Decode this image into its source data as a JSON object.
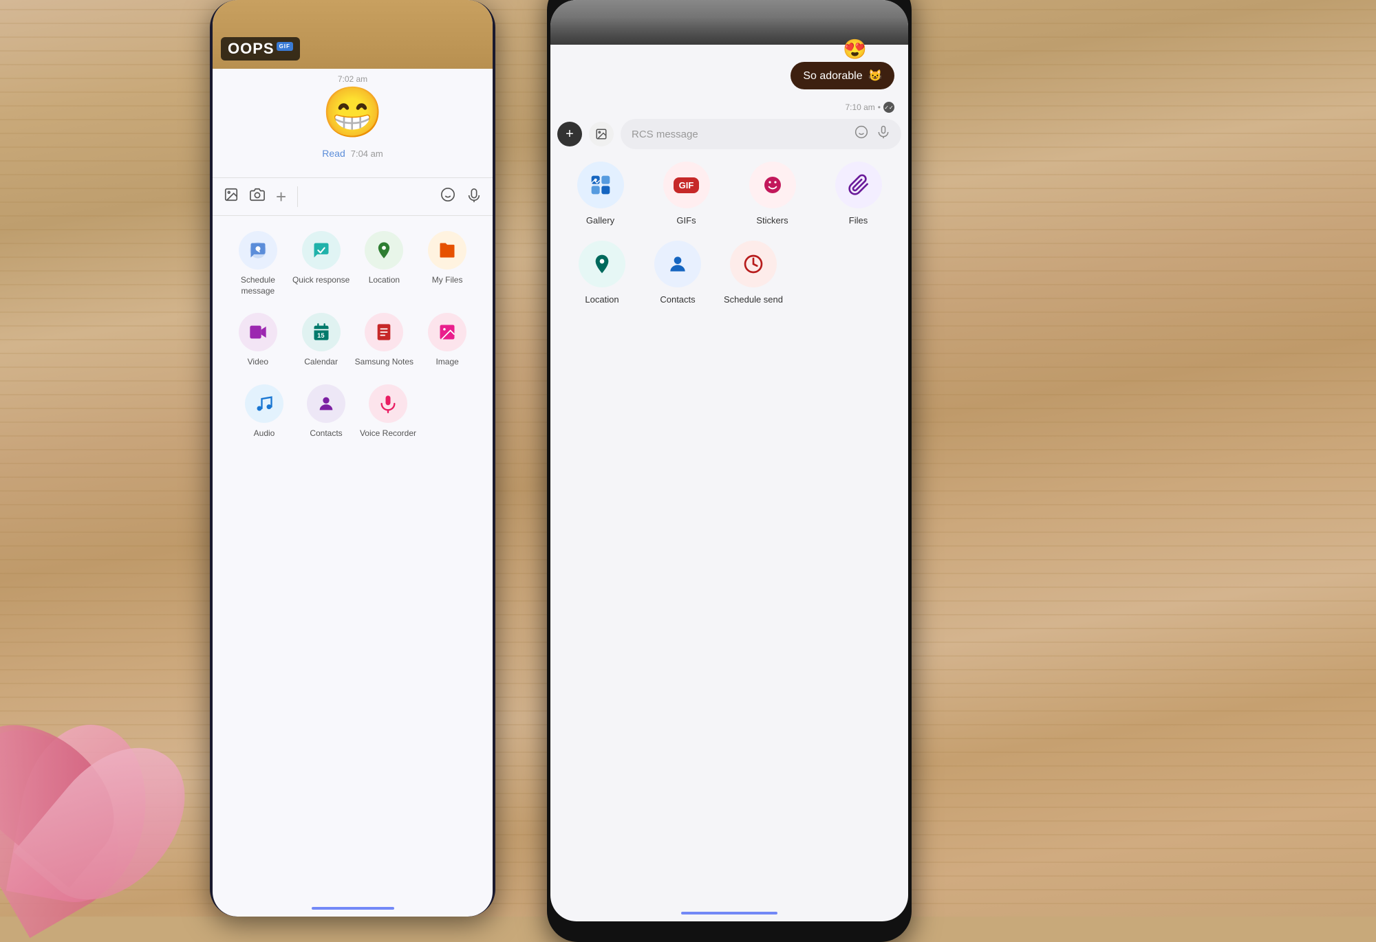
{
  "background": {
    "color": "#c8a97a"
  },
  "phone1": {
    "type": "Samsung Galaxy",
    "gif_text": "OOPS",
    "gif_badge": "GIF",
    "timestamp1": "7:02 am",
    "emoji": "😁",
    "read_label": "Read",
    "timestamp2": "7:04 am",
    "toolbar_icons": [
      "gallery",
      "camera",
      "plus",
      "emoji",
      "voice"
    ],
    "grid": {
      "row1": [
        {
          "label": "Schedule message",
          "icon": "🕐",
          "bg": "blue-light"
        },
        {
          "label": "Quick response",
          "icon": "↗️",
          "bg": "teal"
        },
        {
          "label": "Location",
          "icon": "📍",
          "bg": "green"
        },
        {
          "label": "My Files",
          "icon": "📁",
          "bg": "orange"
        }
      ],
      "row2": [
        {
          "label": "Video",
          "icon": "▶️",
          "bg": "purple"
        },
        {
          "label": "Calendar",
          "icon": "📅",
          "bg": "teal2"
        },
        {
          "label": "Samsung Notes",
          "icon": "📋",
          "bg": "red"
        },
        {
          "label": "Image",
          "icon": "🖼️",
          "bg": "pink"
        }
      ],
      "row3": [
        {
          "label": "Audio",
          "icon": "🎵",
          "bg": "blue2"
        },
        {
          "label": "Contacts",
          "icon": "👤",
          "bg": "purple2"
        },
        {
          "label": "Voice Recorder",
          "icon": "🎙️",
          "bg": "pink2"
        }
      ]
    }
  },
  "phone2": {
    "type": "Google Pixel",
    "emoji_react": "😍",
    "bubble_text": "So adorable",
    "bubble_emoji": "😺",
    "bubble_time": "7:10 am",
    "input_placeholder": "RCS message",
    "grid": {
      "row1": [
        {
          "label": "Gallery",
          "icon": "🖼️",
          "bg": "blue"
        },
        {
          "label": "GIFs",
          "icon": "GIF",
          "bg": "red"
        },
        {
          "label": "Stickers",
          "icon": "😊",
          "bg": "pink"
        },
        {
          "label": "Files",
          "icon": "📎",
          "bg": "purple"
        }
      ],
      "row2": [
        {
          "label": "Location",
          "icon": "📍",
          "bg": "teal"
        },
        {
          "label": "Contacts",
          "icon": "👤",
          "bg": "blue2"
        },
        {
          "label": "Schedule send",
          "icon": "🕐",
          "bg": "red2"
        }
      ]
    }
  }
}
